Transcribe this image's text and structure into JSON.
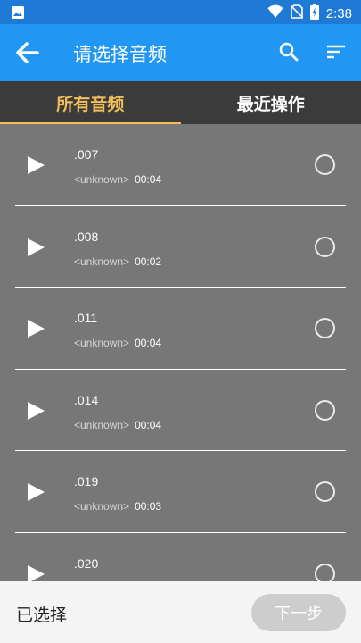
{
  "status_bar": {
    "time": "2:38",
    "icons": [
      "gallery-icon",
      "wifi-icon",
      "no-sim-icon",
      "battery-charging-icon"
    ]
  },
  "app_bar": {
    "title": "请选择音频",
    "icons": [
      "back-arrow-icon",
      "search-icon",
      "sort-icon"
    ]
  },
  "tabs": [
    {
      "label": "所有音频",
      "active": true
    },
    {
      "label": "最近操作",
      "active": false
    }
  ],
  "audio_list": [
    {
      "name": ".007",
      "artist": "<unknown>",
      "duration": "00:04"
    },
    {
      "name": ".008",
      "artist": "<unknown>",
      "duration": "00:02"
    },
    {
      "name": ".011",
      "artist": "<unknown>",
      "duration": "00:04"
    },
    {
      "name": ".014",
      "artist": "<unknown>",
      "duration": "00:04"
    },
    {
      "name": ".019",
      "artist": "<unknown>",
      "duration": "00:03"
    },
    {
      "name": ".020",
      "artist": "",
      "duration": ""
    }
  ],
  "bottom_bar": {
    "selected_label": "已选择",
    "next_label": "下一步"
  },
  "colors": {
    "status_bar": "#1f7ad6",
    "app_bar": "#2196f3",
    "tab_bar": "#3b3b3b",
    "active_tab": "#f2be5c",
    "list_bg": "#777777"
  }
}
